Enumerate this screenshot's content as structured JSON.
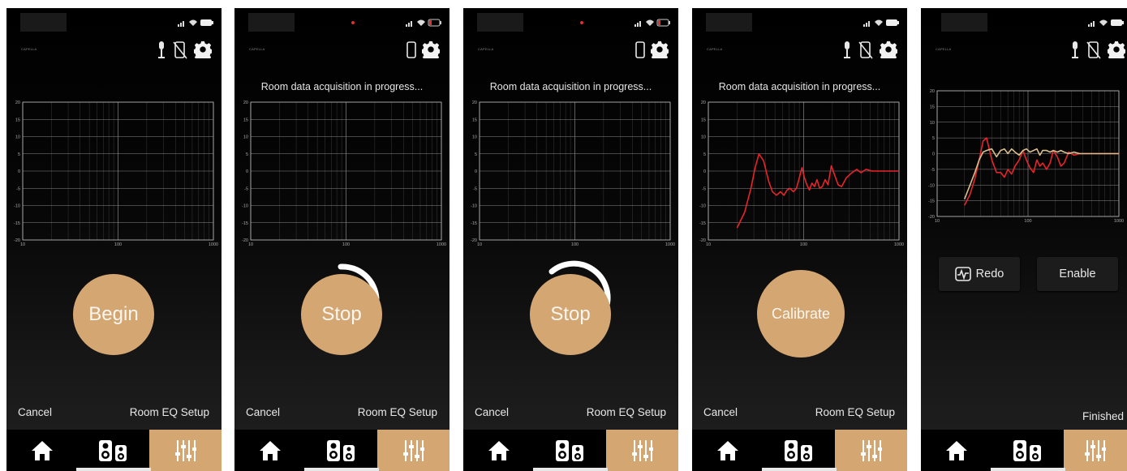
{
  "screens": [
    {
      "brand": "CAPELLA",
      "title": "",
      "main_button": "Begin",
      "cancel": "Cancel",
      "footer_title": "Room EQ Setup"
    },
    {
      "brand": "CAPELLA",
      "title": "Room data acquisition in progress...",
      "main_button": "Stop",
      "cancel": "Cancel",
      "footer_title": "Room EQ Setup"
    },
    {
      "brand": "CAPELLA",
      "title": "Room data acquisition in progress...",
      "main_button": "Stop",
      "cancel": "Cancel",
      "footer_title": "Room EQ Setup"
    },
    {
      "brand": "CAPELLA",
      "title": "Room data acquisition in progress...",
      "main_button": "Calibrate",
      "cancel": "Cancel",
      "footer_title": "Room EQ Setup"
    },
    {
      "brand": "CAPELLA",
      "title": "",
      "redo_label": "Redo",
      "enable_label": "Enable",
      "footer_title": "Finished"
    }
  ],
  "tabs": [
    "home-icon",
    "speakers-icon",
    "equalizer-icon"
  ],
  "colors": {
    "accent": "#d4a672",
    "measured_curve": "#e8242a",
    "corrected_curve": "#d8bf8f",
    "background": "#000000"
  },
  "chart_data": [
    {
      "type": "line",
      "xscale": "log",
      "xlim": [
        10,
        1000
      ],
      "ylim": [
        -20,
        20
      ],
      "xticks": [
        "10",
        "100",
        "1000"
      ],
      "yticks": [
        "20",
        "15",
        "10",
        "5",
        "0",
        "-5",
        "-10",
        "-15",
        "-20"
      ],
      "series": []
    },
    {
      "type": "line",
      "xscale": "log",
      "xlim": [
        10,
        1000
      ],
      "ylim": [
        -20,
        20
      ],
      "xticks": [
        "10",
        "100",
        "1000"
      ],
      "yticks": [
        "20",
        "15",
        "10",
        "5",
        "0",
        "-5",
        "-10",
        "-15",
        "-20"
      ],
      "series": []
    },
    {
      "type": "line",
      "xscale": "log",
      "xlim": [
        10,
        1000
      ],
      "ylim": [
        -20,
        20
      ],
      "xticks": [
        "10",
        "100",
        "1000"
      ],
      "yticks": [
        "20",
        "15",
        "10",
        "5",
        "0",
        "-5",
        "-10",
        "-15",
        "-20"
      ],
      "series": []
    },
    {
      "type": "line",
      "xscale": "log",
      "xlim": [
        10,
        1000
      ],
      "ylim": [
        -20,
        20
      ],
      "xticks": [
        "10",
        "100",
        "1000"
      ],
      "yticks": [
        "20",
        "15",
        "10",
        "5",
        "0",
        "-5",
        "-10",
        "-15",
        "-20"
      ],
      "series": [
        {
          "color": "#e8242a",
          "x": [
            20,
            24,
            28,
            31,
            34,
            38,
            43,
            47,
            52,
            57,
            62,
            67,
            72,
            78,
            84,
            90,
            96,
            102,
            108,
            115,
            122,
            130,
            138,
            147,
            157,
            168,
            180,
            195,
            210,
            230,
            250,
            280,
            320,
            360,
            400,
            450,
            520,
            600,
            700,
            850,
            1000
          ],
          "y": [
            -16.5,
            -12,
            -5,
            1,
            5,
            3,
            -3,
            -6,
            -7,
            -6,
            -7,
            -5.5,
            -5,
            -6,
            -5,
            -2,
            1,
            -2,
            -4,
            -5.5,
            -3.5,
            -4.5,
            -2.5,
            -5,
            -4.5,
            -2.5,
            -4,
            1.5,
            -1,
            -4,
            -4.5,
            -2,
            -0.5,
            0.5,
            -0.5,
            0.5,
            0,
            0,
            0,
            0,
            0
          ]
        }
      ]
    },
    {
      "type": "line",
      "xscale": "log",
      "xlim": [
        10,
        1000
      ],
      "ylim": [
        -20,
        20
      ],
      "xticks": [
        "10",
        "100",
        "1000"
      ],
      "yticks": [
        "20",
        "15",
        "10",
        "5",
        "0",
        "-5",
        "-10",
        "-15",
        "-20"
      ],
      "series": [
        {
          "color": "#e8242a",
          "x": [
            20,
            23,
            26,
            29,
            32,
            35,
            40,
            45,
            50,
            55,
            60,
            66,
            72,
            80,
            88,
            96,
            105,
            115,
            125,
            135,
            145,
            160,
            175,
            190,
            210,
            230,
            250,
            280,
            320,
            370,
            420,
            500,
            600,
            800,
            1000
          ],
          "y": [
            -16.5,
            -13,
            -8,
            -2,
            4,
            5,
            -2,
            -6,
            -6,
            -7.5,
            -5,
            -6.5,
            -4,
            -2,
            1,
            -2,
            -4.5,
            -6,
            -2,
            -4,
            -3,
            -5,
            -3,
            1,
            -1,
            -4,
            -3,
            0.5,
            -0.5,
            0,
            0,
            0,
            0,
            0,
            0
          ]
        },
        {
          "color": "#d8bf8f",
          "x": [
            20,
            23,
            26,
            29,
            32,
            35,
            40,
            45,
            50,
            55,
            60,
            66,
            72,
            80,
            88,
            96,
            105,
            115,
            125,
            135,
            145,
            160,
            175,
            190,
            210,
            230,
            250,
            280,
            320,
            370,
            420,
            500,
            600,
            800,
            1000
          ],
          "y": [
            -14.5,
            -10,
            -6,
            -2,
            0.5,
            1,
            1.5,
            -1,
            1,
            1.5,
            0,
            1.5,
            0.5,
            -0.5,
            1,
            1.5,
            0.5,
            1,
            1.5,
            -0.5,
            1,
            1,
            0.5,
            1,
            0.5,
            1,
            0.5,
            0,
            0.5,
            0,
            0,
            0,
            0,
            0,
            0
          ]
        }
      ]
    }
  ]
}
